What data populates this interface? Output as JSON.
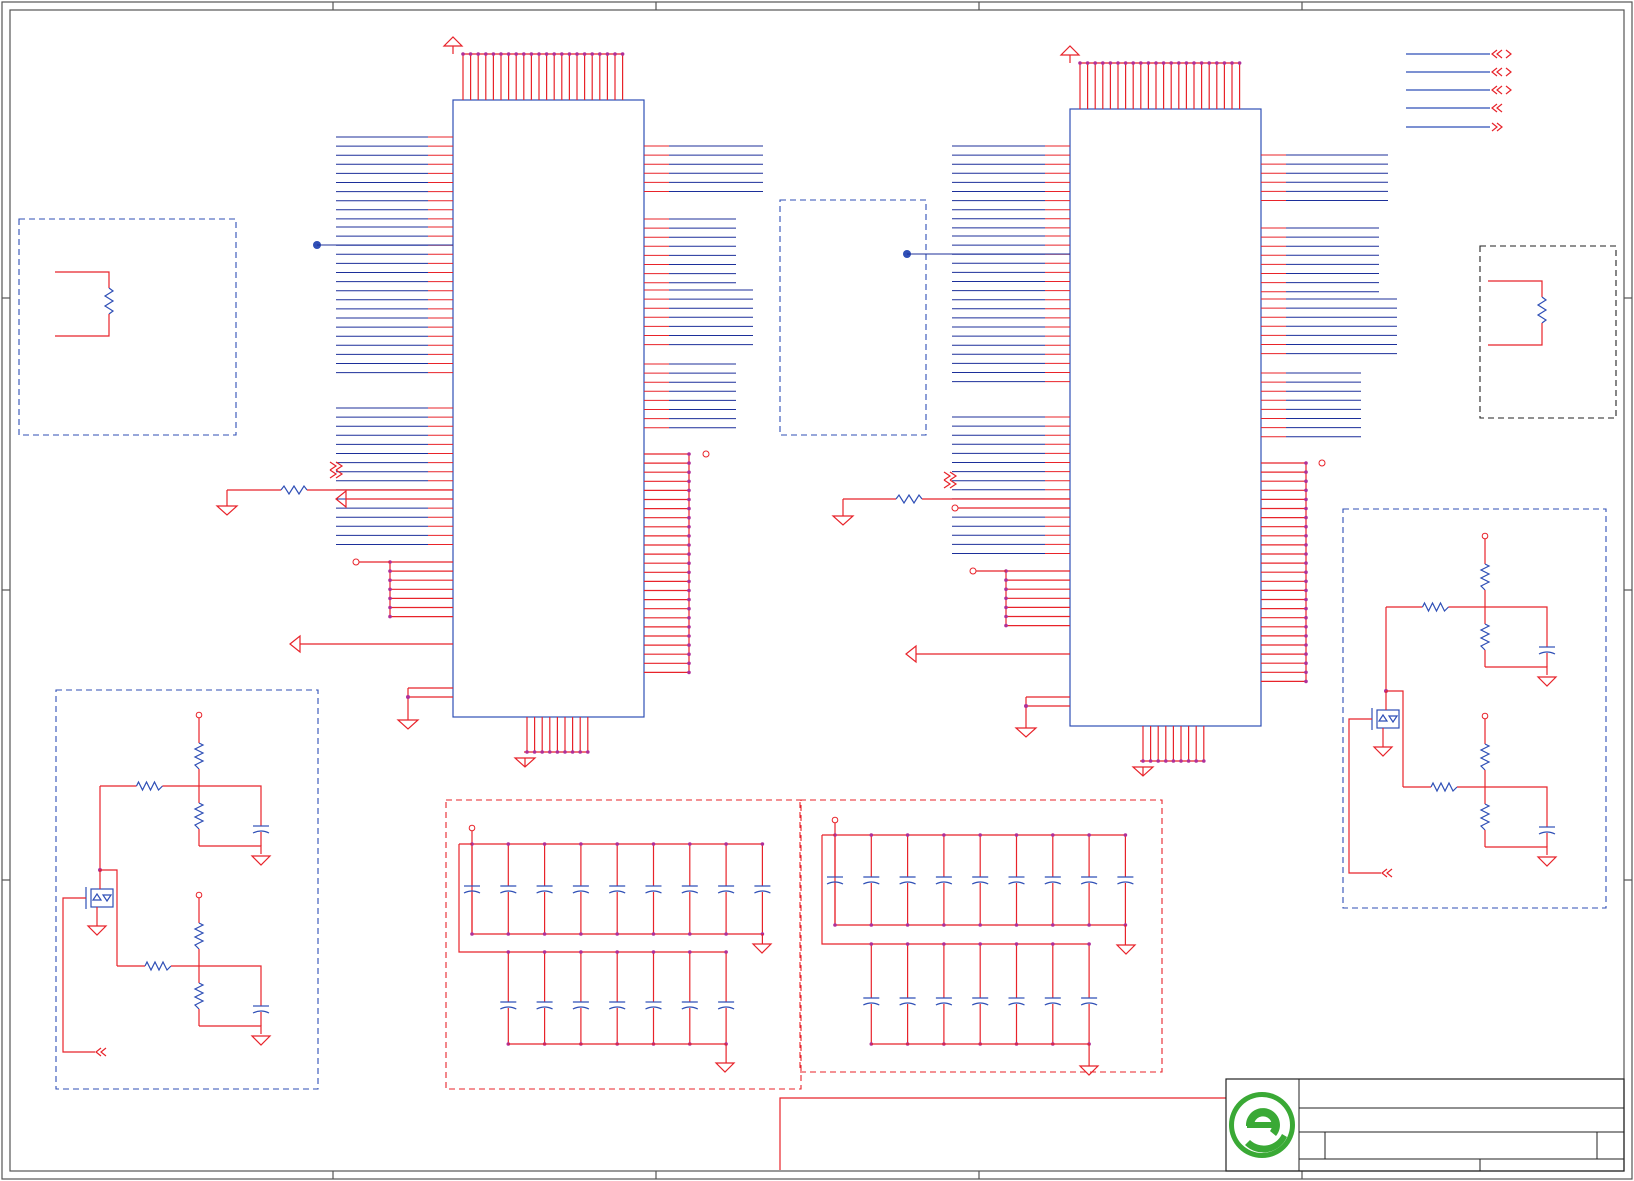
{
  "sheet": {
    "title": ""
  },
  "colors": {
    "wire": "#e8232a",
    "net": "#1c2f9a",
    "component": "#2f4fb6",
    "junction": "#b0309a",
    "logo": "#3aa935"
  },
  "icons": [
    "ground-symbol",
    "resistor-symbol",
    "capacitor-symbol",
    "mosfet-symbol",
    "offpage-connector",
    "power-port",
    "company-logo"
  ]
}
